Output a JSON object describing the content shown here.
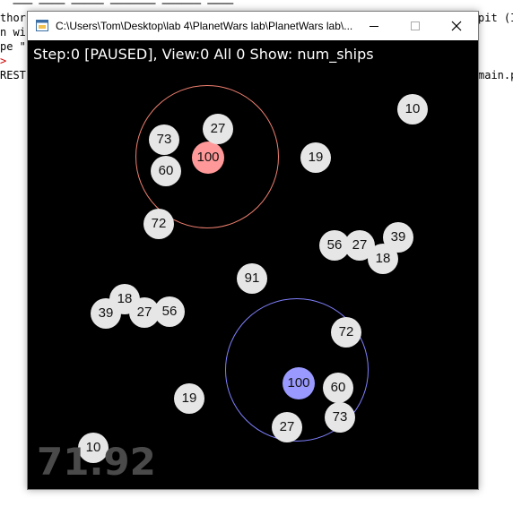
{
  "background_editor": {
    "lines": [
      "thor",
      "n wi",
      "pe \"",
      ">",
      "REST"
    ],
    "right_fragments": [
      "pit (I",
      "main.p"
    ]
  },
  "window": {
    "title": "C:\\Users\\Tom\\Desktop\\lab 4\\PlanetWars lab\\PlanetWars lab\\...",
    "controls": {
      "minimize": "minimize",
      "maximize": "maximize",
      "close": "close"
    }
  },
  "game": {
    "status": "Step:0 [PAUSED], View:0 All 0 Show: num_ships",
    "timer": "71.92",
    "colors": {
      "player1": "#ff9999",
      "player1_ring": "#f08070",
      "player2": "#9999ff",
      "player2_ring": "#8080ff",
      "neutral": "#e6e6e6"
    },
    "planets": [
      {
        "ships": "100",
        "owner": "player1"
      },
      {
        "ships": "73",
        "owner": "neutral"
      },
      {
        "ships": "27",
        "owner": "neutral"
      },
      {
        "ships": "60",
        "owner": "neutral"
      },
      {
        "ships": "72",
        "owner": "neutral"
      },
      {
        "ships": "19",
        "owner": "neutral"
      },
      {
        "ships": "10",
        "owner": "neutral"
      },
      {
        "ships": "56",
        "owner": "neutral"
      },
      {
        "ships": "27",
        "owner": "neutral"
      },
      {
        "ships": "39",
        "owner": "neutral"
      },
      {
        "ships": "18",
        "owner": "neutral"
      },
      {
        "ships": "91",
        "owner": "neutral"
      },
      {
        "ships": "18",
        "owner": "neutral"
      },
      {
        "ships": "39",
        "owner": "neutral"
      },
      {
        "ships": "27",
        "owner": "neutral"
      },
      {
        "ships": "56",
        "owner": "neutral"
      },
      {
        "ships": "72",
        "owner": "neutral"
      },
      {
        "ships": "100",
        "owner": "player2"
      },
      {
        "ships": "60",
        "owner": "neutral"
      },
      {
        "ships": "73",
        "owner": "neutral"
      },
      {
        "ships": "27",
        "owner": "neutral"
      },
      {
        "ships": "19",
        "owner": "neutral"
      },
      {
        "ships": "10",
        "owner": "neutral"
      }
    ]
  }
}
